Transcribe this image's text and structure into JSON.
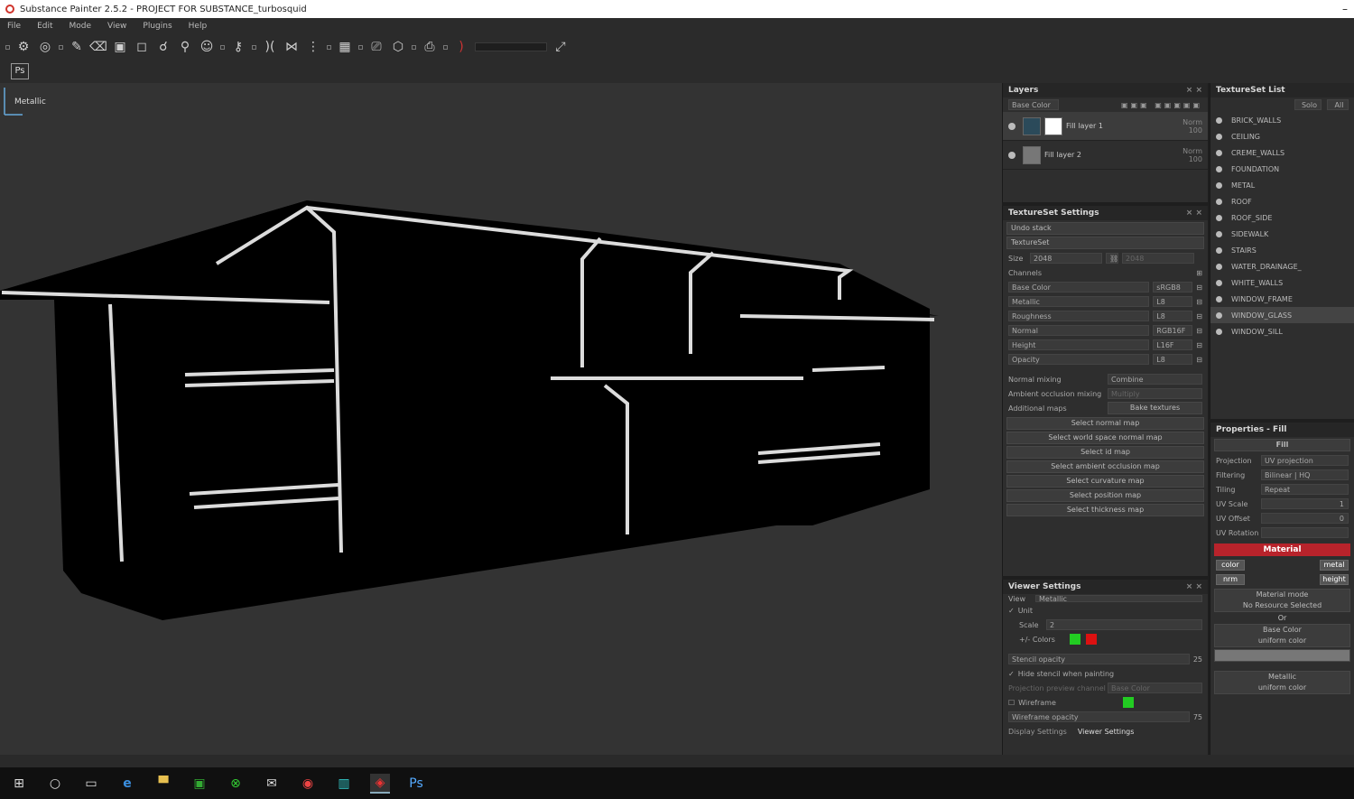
{
  "window": {
    "title": "Substance Painter 2.5.2 - PROJECT FOR SUBSTANCE_turbosquid"
  },
  "menu": [
    "File",
    "Edit",
    "Mode",
    "View",
    "Plugins",
    "Help"
  ],
  "toolbar": {
    "ps_label": "Ps",
    "icons": [
      "paint-brush-icon",
      "eraser-icon",
      "projection-icon",
      "polygon-fill-icon",
      "smudge-icon",
      "clone-icon",
      "material-picker-icon",
      "symmetry-icon",
      "camera-icon"
    ]
  },
  "viewport": {
    "channel_label": "Metallic"
  },
  "layers": {
    "title": "Layers",
    "channel_select": "Base Color",
    "items": [
      {
        "name": "Fill layer 1",
        "blend": "Norm",
        "opacity": "100"
      },
      {
        "name": "Fill layer 2",
        "blend": "Norm",
        "opacity": "100"
      }
    ]
  },
  "texture_set_settings": {
    "title": "TextureSet Settings",
    "undo_stack": "Undo stack",
    "textureset_label": "TextureSet",
    "size_label": "Size",
    "size_value": "2048",
    "size_value_2": "2048",
    "channels_label": "Channels",
    "channels": [
      {
        "name": "Base Color",
        "format": "sRGB8"
      },
      {
        "name": "Metallic",
        "format": "L8"
      },
      {
        "name": "Roughness",
        "format": "L8"
      },
      {
        "name": "Normal",
        "format": "RGB16F"
      },
      {
        "name": "Height",
        "format": "L16F"
      },
      {
        "name": "Opacity",
        "format": "L8"
      }
    ],
    "normal_mixing_label": "Normal mixing",
    "normal_mixing_value": "Combine",
    "ao_mixing_label": "Ambient occlusion mixing",
    "ao_mixing_value": "Multiply",
    "additional_maps_label": "Additional maps",
    "bake_button": "Bake textures",
    "map_buttons": [
      "Select normal map",
      "Select world space normal map",
      "Select id map",
      "Select ambient occlusion map",
      "Select curvature map",
      "Select position map",
      "Select thickness map"
    ]
  },
  "viewer_settings": {
    "title": "Viewer Settings",
    "view_label": "View",
    "view_value": "Metallic",
    "unit_label": "Unit",
    "scale_label": "Scale",
    "scale_value": "2",
    "colors_label": "+/- Colors",
    "color_pos": "#22cc22",
    "color_neg": "#dd1111",
    "stencil_label": "Stencil opacity",
    "stencil_value": "25",
    "hide_stencil_label": "Hide stencil when painting",
    "projection_label": "Projection preview channel",
    "projection_value": "Base Color",
    "wireframe_label": "Wireframe",
    "wireframe_color": "#22cc22",
    "wireframe_opacity_label": "Wireframe opacity",
    "wireframe_opacity_value": "75",
    "tabs": [
      "Display Settings",
      "Viewer Settings"
    ]
  },
  "textureset_list": {
    "title": "TextureSet List",
    "solo_button": "Solo",
    "all_button": "All",
    "items": [
      "BRICK_WALLS",
      "CEILING",
      "CREME_WALLS",
      "FOUNDATION",
      "METAL",
      "ROOF",
      "ROOF_SIDE",
      "SIDEWALK",
      "STAIRS",
      "WATER_DRAINAGE_",
      "WHITE_WALLS",
      "WINDOW_FRAME",
      "WINDOW_GLASS",
      "WINDOW_SILL"
    ],
    "selected": "WINDOW_GLASS"
  },
  "properties": {
    "title": "Properties - Fill",
    "section": "Fill",
    "projection_label": "Projection",
    "projection_value": "UV projection",
    "filtering_label": "Filtering",
    "filtering_value": "Bilinear | HQ",
    "tiling_label": "Tiling",
    "tiling_value": "Repeat",
    "uv_scale_label": "UV Scale",
    "uv_scale_value": "1",
    "uv_offset_label": "UV Offset",
    "uv_offset_value": "0",
    "uv_rotation_label": "UV Rotation",
    "material_title": "Material",
    "mat_buttons": [
      "color",
      "metal",
      "nrm",
      "height"
    ],
    "material_mode_label": "Material mode",
    "material_mode_value": "No Resource Selected",
    "or_label": "Or",
    "base_color_label": "Base Color",
    "base_color_value": "uniform color",
    "metallic_label": "Metallic",
    "metallic_value": "uniform color"
  },
  "taskbar": [
    "windows-start-icon",
    "search-icon",
    "task-view-icon",
    "edge-icon",
    "file-explorer-icon",
    "store-icon",
    "xbox-icon",
    "mail-icon",
    "chrome-icon",
    "substance-designer-icon",
    "substance-painter-icon",
    "photoshop-icon"
  ]
}
